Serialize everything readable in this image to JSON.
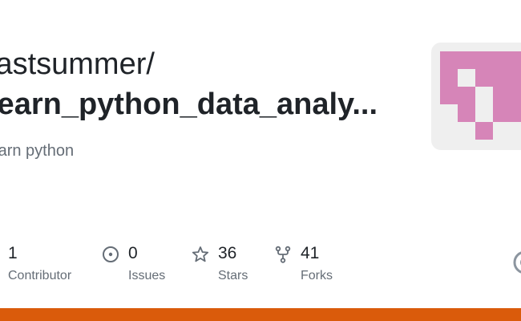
{
  "repo_card": {
    "owner": "lastsummer/",
    "repo_name": "learn_python_data_analy...",
    "description": "learn python"
  },
  "stats": {
    "contributors": {
      "count": "1",
      "label": "Contributor",
      "icon": "people-icon"
    },
    "issues": {
      "count": "0",
      "label": "Issues",
      "icon": "issue-opened-icon"
    },
    "stars": {
      "count": "36",
      "label": "Stars",
      "icon": "star-icon"
    },
    "forks": {
      "count": "41",
      "label": "Forks",
      "icon": "repo-forked-icon"
    }
  },
  "colors": {
    "accent_bar": "#da5b0b",
    "avatar_pixel": "#d685b8",
    "avatar_background": "#efefef",
    "text_primary": "#1f2328",
    "text_secondary": "#656d76"
  },
  "icons": {
    "avatar": "identicon-avatar",
    "brand": "github-mark-icon"
  }
}
